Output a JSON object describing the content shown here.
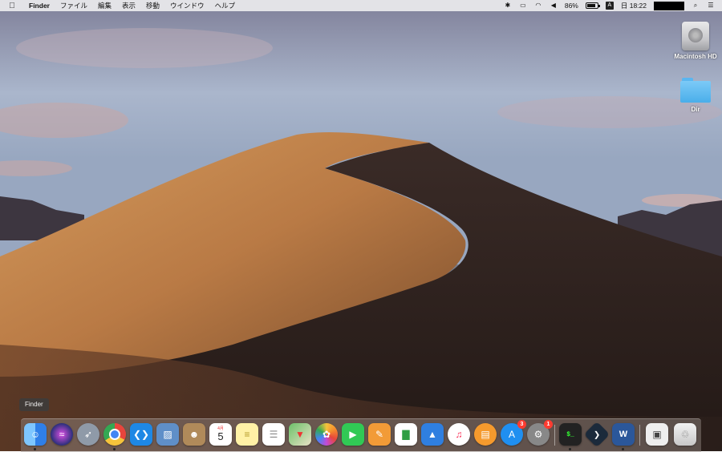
{
  "menubar": {
    "apple_icon": "apple-icon",
    "app_name": "Finder",
    "menus": [
      "ファイル",
      "編集",
      "表示",
      "移動",
      "ウインドウ",
      "ヘルプ"
    ],
    "battery_percent": "86%",
    "battery_level": 0.86,
    "input_source": "A",
    "clock": "日 18:22"
  },
  "desktop": {
    "icons": [
      {
        "label": "Macintosh HD",
        "icon": "hard-drive-icon"
      },
      {
        "label": "Dir",
        "icon": "folder-icon"
      }
    ]
  },
  "tooltip": "Finder",
  "dock": {
    "calendar_day": "5",
    "calendar_month": "4月",
    "appstore_badge": "3",
    "settings_badge": "1",
    "terminal_prompt": "$_",
    "word_letter": "W",
    "colors": {
      "finder": "#3d8ff5",
      "siri": "#2a2f7a",
      "launchpad": "#8f9aa8",
      "chrome": "#e8453c",
      "vscode": "#1e88e5",
      "preview": "#5f8fc8",
      "contacts": "#b08a5a",
      "calendar": "#ffffff",
      "notes": "#fff1a6",
      "reminders": "#ffffff",
      "maps": "#6cc16a",
      "photos": "#ffffff",
      "facetime": "#31c955",
      "pages": "#f29b37",
      "numbers": "#ffffff",
      "keynote": "#2f7fe0",
      "music": "#ffffff",
      "books": "#f59a2d",
      "appstore": "#1f8ff0",
      "settings": "#888888",
      "terminal": "#222222",
      "dev": "#1b2a3b",
      "word": "#2b579a",
      "window": "#eeeeee",
      "trash": "#dcdcdc"
    }
  }
}
